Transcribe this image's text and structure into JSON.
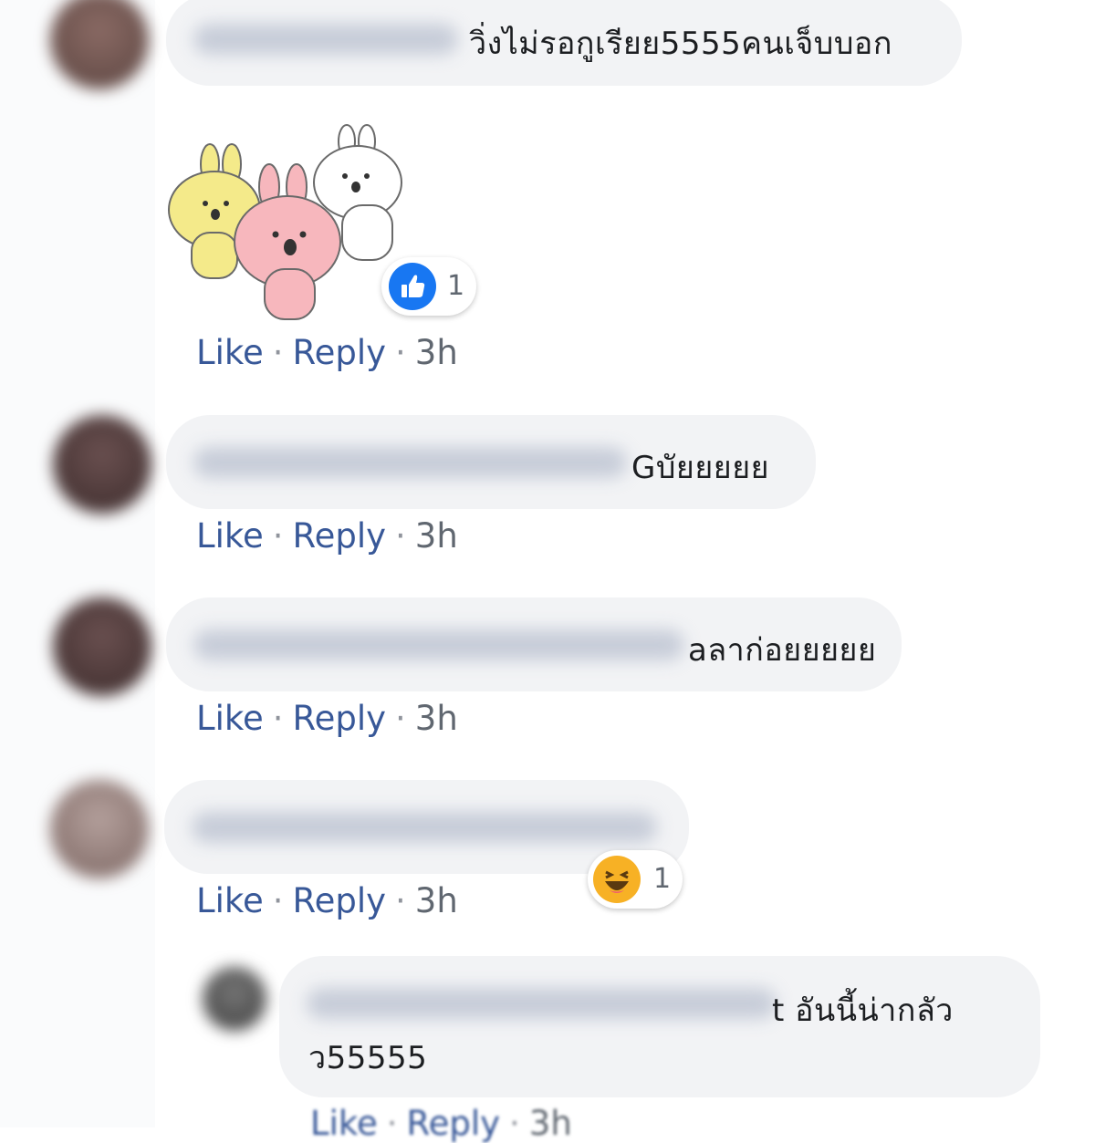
{
  "comments": [
    {
      "text_visible": "วิ่งไม่รอกูเรียย5555คนเจ็บบอก",
      "actions": {
        "like": "Like",
        "reply": "Reply",
        "time": "3h"
      },
      "reaction": {
        "icon": "like-icon",
        "count": "1"
      },
      "sticker": "three-bunnies-sticker"
    },
    {
      "text_visible": "Gบัยยยยย",
      "actions": {
        "like": "Like",
        "reply": "Reply",
        "time": "3h"
      }
    },
    {
      "text_visible": "aลาก่อยยยยย",
      "actions": {
        "like": "Like",
        "reply": "Reply",
        "time": "3h"
      }
    },
    {
      "text_visible": "",
      "actions": {
        "like": "Like",
        "reply": "Reply",
        "time": "3h"
      },
      "reaction": {
        "icon": "haha-icon",
        "count": "1"
      }
    }
  ],
  "reply": {
    "text_line1": "t อันนี้น่ากลัว",
    "text_line2": "ว55555",
    "actions": {
      "like": "Like",
      "reply": "Reply",
      "time": "3h"
    }
  },
  "colors": {
    "link": "#385898",
    "bubble": "#f2f3f5",
    "text": "#1c1e21",
    "meta": "#606770",
    "like_blue": "#1877f2",
    "haha_yellow": "#f7b125"
  }
}
